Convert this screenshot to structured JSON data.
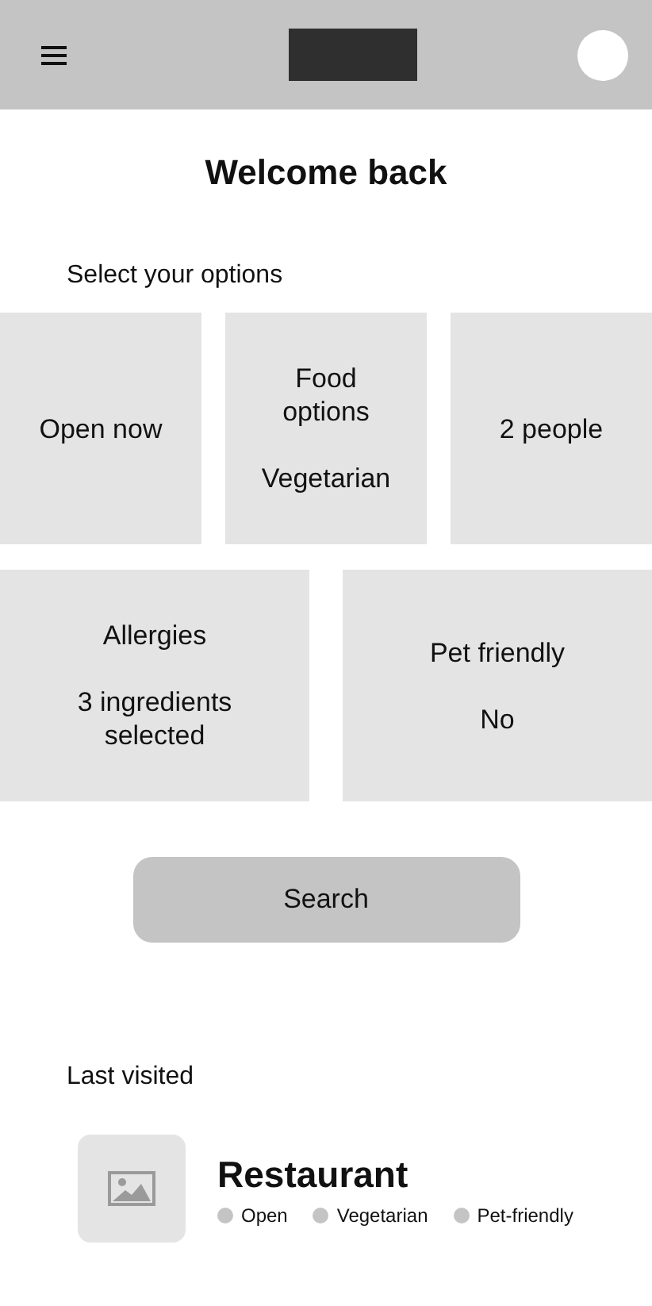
{
  "header": {
    "kind": "app-bar"
  },
  "title": "Welcome back",
  "options_heading": "Select your options",
  "option_rows": [
    [
      {
        "label": "Open now"
      },
      {
        "label": "Food options",
        "value": "Vegetarian"
      },
      {
        "label": "2 people"
      }
    ],
    [
      {
        "label": "Allergies",
        "value": "3 ingredients selected"
      },
      {
        "label": "Pet friendly",
        "value": "No"
      }
    ]
  ],
  "search_button": "Search",
  "last_visited_heading": "Last visited",
  "last_visited": [
    {
      "thumbnail": {
        "kind": "image-placeholder"
      },
      "name": "Restaurant",
      "tags": [
        "Open",
        "Vegetarian",
        "Pet-friendly"
      ]
    }
  ]
}
